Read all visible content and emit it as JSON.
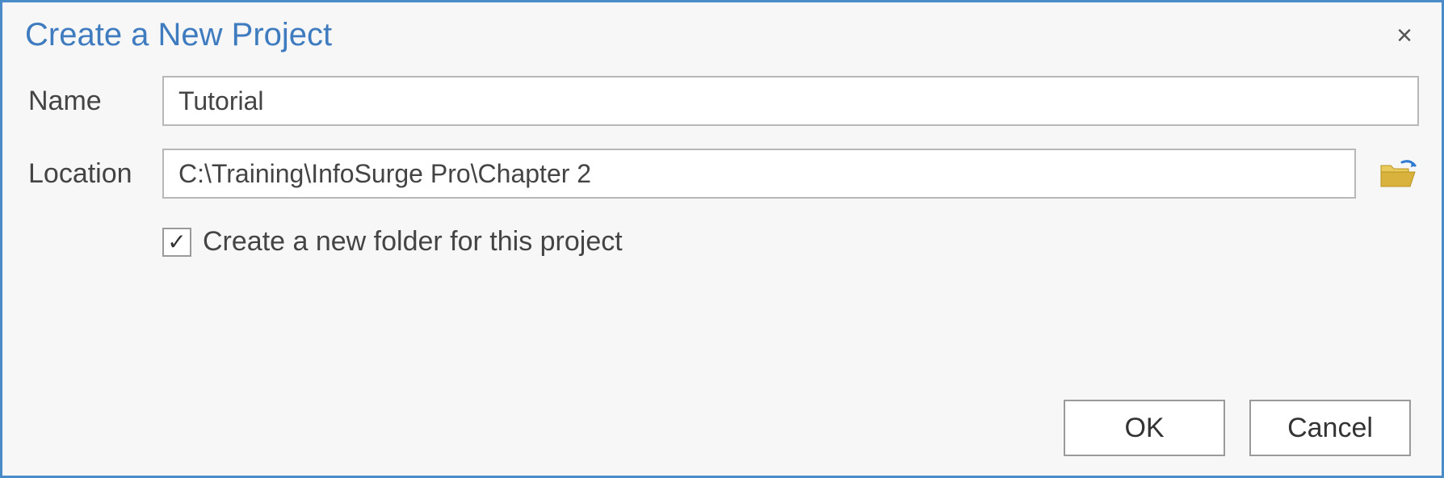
{
  "dialog": {
    "title": "Create a New Project",
    "close_icon": "×"
  },
  "form": {
    "name_label": "Name",
    "name_value": "Tutorial",
    "location_label": "Location",
    "location_value": "C:\\Training\\InfoSurge Pro\\Chapter 2",
    "browse_icon": "folder-open-icon",
    "create_folder_checked": true,
    "create_folder_label": "Create a new folder for this project"
  },
  "buttons": {
    "ok_label": "OK",
    "cancel_label": "Cancel"
  },
  "colors": {
    "accent": "#4a8bc9",
    "folder": "#d9b23d",
    "arrow": "#2f7bd1"
  }
}
